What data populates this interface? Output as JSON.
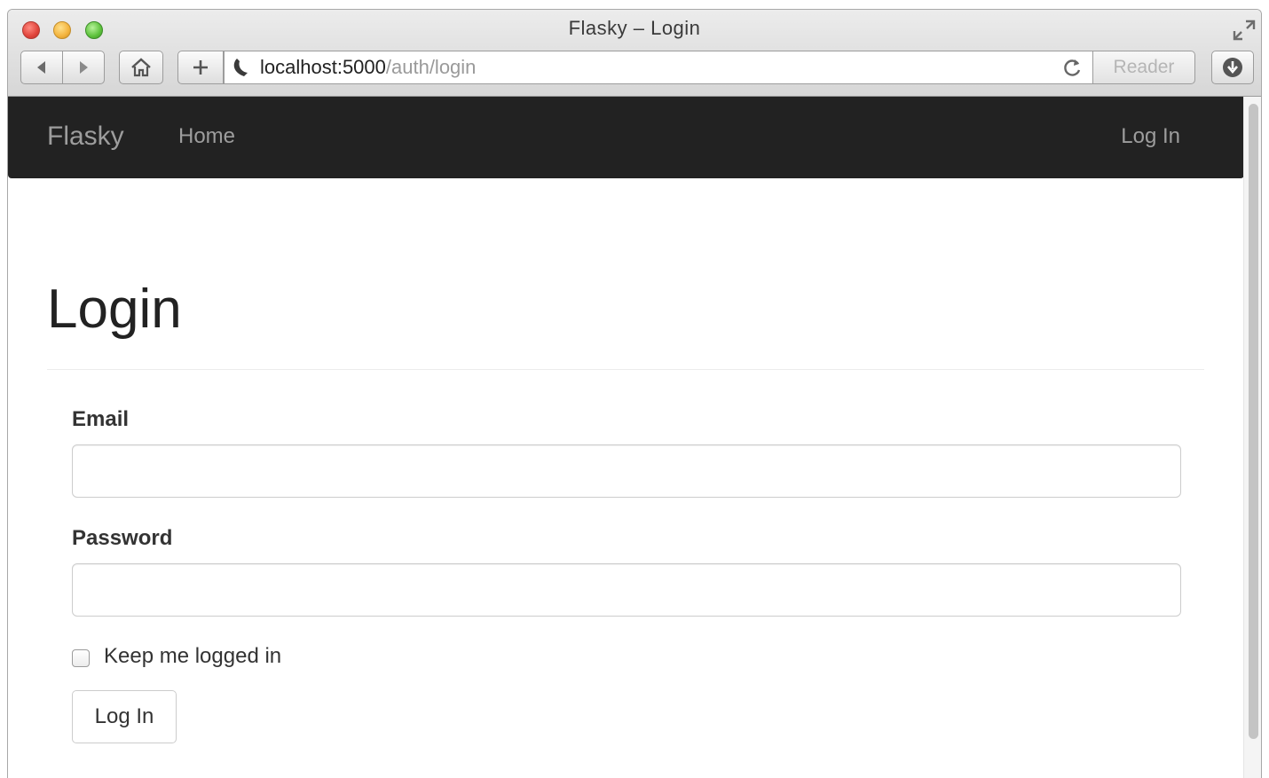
{
  "window": {
    "title": "Flasky – Login"
  },
  "toolbar": {
    "url_host": "localhost:5000",
    "url_path": "/auth/login",
    "reader_label": "Reader"
  },
  "navbar": {
    "brand": "Flasky",
    "home": "Home",
    "login": "Log In",
    "background": "#222222",
    "link_color": "#9d9d9d"
  },
  "main": {
    "title": "Login",
    "email_label": "Email",
    "email_value": "",
    "password_label": "Password",
    "password_value": "",
    "remember_label": "Keep me logged in",
    "remember_checked": false,
    "submit_label": "Log In"
  }
}
